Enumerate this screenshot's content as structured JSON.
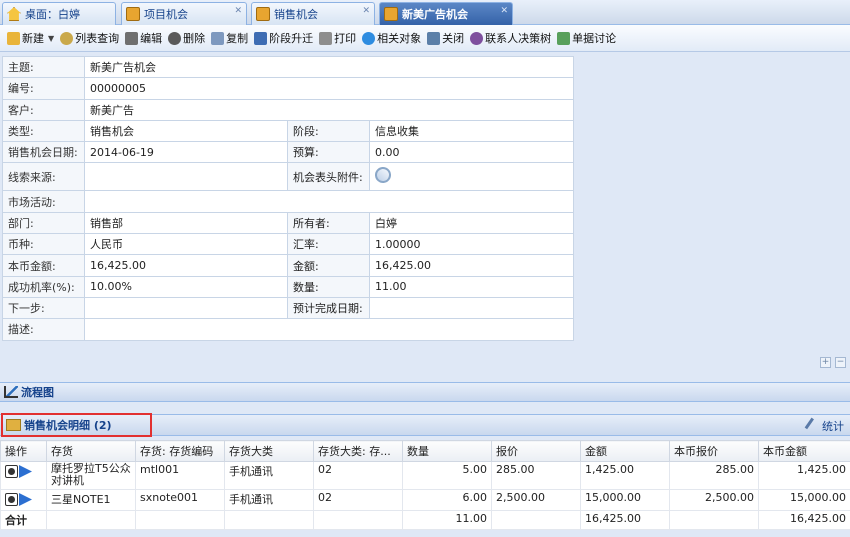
{
  "tabs": [
    {
      "label": "桌面：白婷",
      "icon": "home-icon",
      "active": false
    },
    {
      "label": "项目机会",
      "icon": "chart-icon",
      "active": false
    },
    {
      "label": "销售机会",
      "icon": "chart-icon",
      "active": false
    },
    {
      "label": "新美广告机会",
      "icon": "chart-icon",
      "active": true
    }
  ],
  "toolbar": {
    "new": "新建",
    "list_query": "列表查询",
    "edit": "编辑",
    "delete": "删除",
    "copy": "复制",
    "stage_upgrade": "阶段升迁",
    "print": "打印",
    "related": "相关对象",
    "close": "关闭",
    "contact_tree": "联系人决策树",
    "doc_discuss": "单据讨论"
  },
  "form": {
    "subject_label": "主题:",
    "subject": "新美广告机会",
    "code_label": "编号:",
    "code": "00000005",
    "customer_label": "客户:",
    "customer": "新美广告",
    "type_label": "类型:",
    "type": "销售机会",
    "stage_label": "阶段:",
    "stage": "信息收集",
    "date_label": "销售机会日期:",
    "date": "2014-06-19",
    "budget_label": "预算:",
    "budget": "0.00",
    "lead_label": "线索来源:",
    "lead": "",
    "attach_label": "机会表头附件:",
    "campaign_label": "市场活动:",
    "campaign": "",
    "dept_label": "部门:",
    "dept": "销售部",
    "owner_label": "所有者:",
    "owner": "白婷",
    "currency_label": "币种:",
    "currency": "人民币",
    "rate_label": "汇率:",
    "rate": "1.00000",
    "local_amount_label": "本币金额:",
    "local_amount": "16,425.00",
    "amount_label": "金额:",
    "amount": "16,425.00",
    "success_rate_label": "成功机率(%):",
    "success_rate": "10.00%",
    "qty_label": "数量:",
    "qty": "11.00",
    "next_step_label": "下一步:",
    "next_step": "",
    "est_date_label": "预计完成日期:",
    "est_date": "",
    "desc_label": "描述:",
    "desc": ""
  },
  "sections": {
    "flowchart": "流程图",
    "detail": "销售机会明细 (2)",
    "stats": "统计"
  },
  "grid": {
    "headers": [
      "操作",
      "存货",
      "存货: 存货编码",
      "存货大类",
      "存货大类: 存...",
      "数量",
      "报价",
      "金额",
      "本币报价",
      "本币金额"
    ],
    "rows": [
      {
        "item": "摩托罗拉T5公众对讲机",
        "code": "mtl001",
        "cat": "手机通讯",
        "cat_code": "02",
        "qty": "5.00",
        "price": "285.00",
        "amount": "1,425.00",
        "local_price": "285.00",
        "local_amount": "1,425.00"
      },
      {
        "item": "三星NOTE1",
        "code": "sxnote001",
        "cat": "手机通讯",
        "cat_code": "02",
        "qty": "6.00",
        "price": "2,500.00",
        "amount": "15,000.00",
        "local_price": "2,500.00",
        "local_amount": "15,000.00"
      }
    ],
    "total": {
      "label": "合计",
      "qty": "11.00",
      "amount": "16,425.00",
      "local_amount": "16,425.00"
    }
  }
}
